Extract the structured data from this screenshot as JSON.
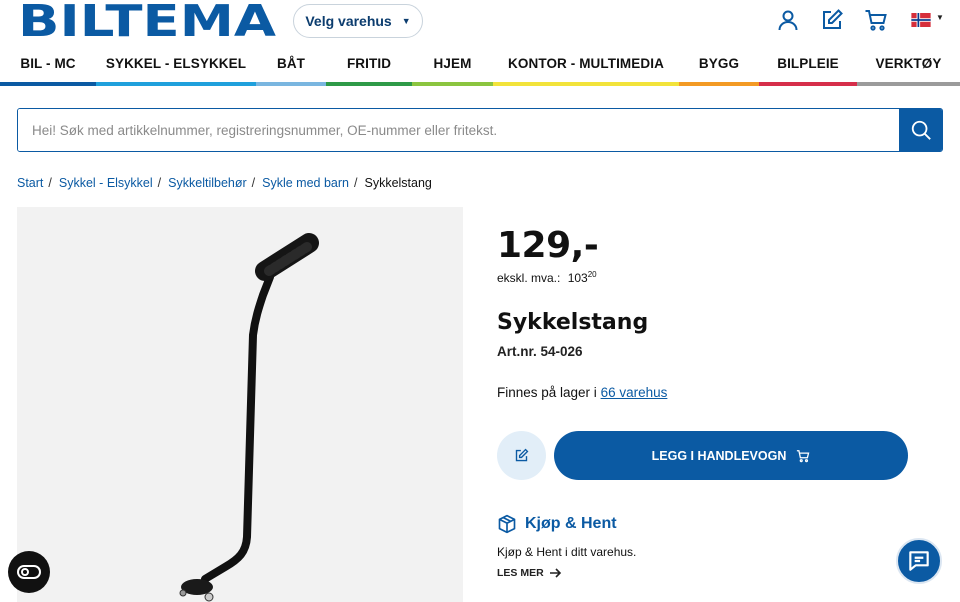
{
  "brand": {
    "logo_text": "BILTEMA",
    "color": "#0b5aa3"
  },
  "header": {
    "store_button_label": "Velg varehus",
    "icons": [
      "user-icon",
      "edit-list-icon",
      "cart-icon",
      "norway-flag-icon"
    ]
  },
  "nav": {
    "items": [
      {
        "label": "BIL - MC",
        "color": "#0b5aa3"
      },
      {
        "label": "SYKKEL - ELSYKKEL",
        "color": "#1fa0dc"
      },
      {
        "label": "BÅT",
        "color": "#7ab6e0"
      },
      {
        "label": "FRITID",
        "color": "#2e9a48"
      },
      {
        "label": "HJEM",
        "color": "#8bc53f"
      },
      {
        "label": "KONTOR - MULTIMEDIA",
        "color": "#f2e33a"
      },
      {
        "label": "BYGG",
        "color": "#f39a24"
      },
      {
        "label": "BILPLEIE",
        "color": "#d62e4a"
      },
      {
        "label": "VERKTØY",
        "color": "#9b9b9b"
      }
    ]
  },
  "search": {
    "placeholder": "Hei! Søk med artikkelnummer, registreringsnummer, OE-nummer eller fritekst."
  },
  "breadcrumb": [
    "Start",
    "Sykkel - Elsykkel",
    "Sykkeltilbehør",
    "Sykle med barn",
    "Sykkelstang"
  ],
  "product": {
    "price": "129,-",
    "vat_label": "ekskl. mva.:",
    "vat_value": "103",
    "vat_decimals": "20",
    "title": "Sykkelstang",
    "artnr": "Art.nr. 54-026",
    "stock_prefix": "Finnes på lager i",
    "stock_link": "66 varehus",
    "cart_button": "LEGG I HANDLEVOGN"
  },
  "click_collect": {
    "title": "Kjøp & Hent",
    "text": "Kjøp & Hent i ditt varehus.",
    "more": "LES MER"
  }
}
